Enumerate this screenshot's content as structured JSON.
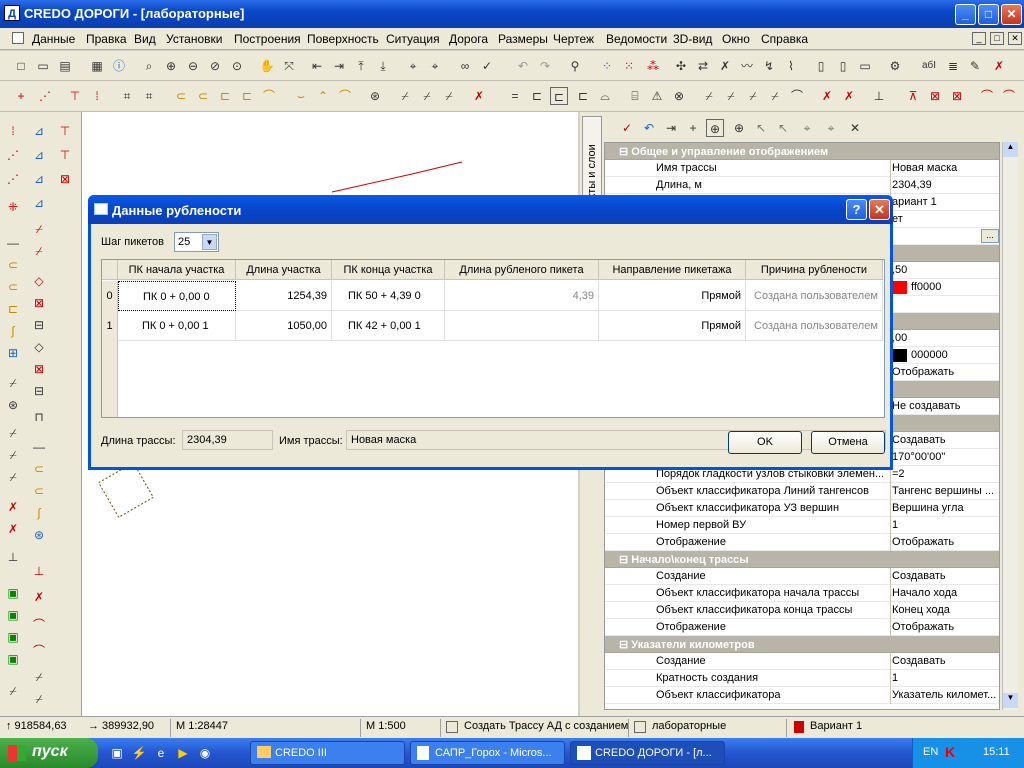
{
  "app": {
    "title": "CREDO ДОРОГИ - [лабораторные]",
    "icon_letter": "Д"
  },
  "window_controls": {
    "minimize": "_",
    "maximize": "□",
    "close": "✕"
  },
  "menu": [
    "Данные",
    "Правка",
    "Вид",
    "Установки",
    "Построения",
    "Поверхность",
    "Ситуация",
    "Дорога",
    "Размеры",
    "Чертеж",
    "Ведомости",
    "3D-вид",
    "Окно",
    "Справка"
  ],
  "right_panel": {
    "vertical_tab": "роекты и слои",
    "groups": [
      {
        "label": "Общее и управление отображением"
      }
    ],
    "rows": [
      {
        "type": "group",
        "name": "Общее и управление отображением"
      },
      {
        "name": "Имя трассы",
        "value": "Новая маска"
      },
      {
        "name": "Длина, м",
        "value": "2304,39"
      },
      {
        "name": "",
        "value": "ариант 1"
      },
      {
        "name": "",
        "value": "ет"
      },
      {
        "name": "",
        "value": ""
      },
      {
        "type": "group",
        "name": ""
      },
      {
        "name": "",
        "value": ",50"
      },
      {
        "name": "",
        "value": "ff0000"
      },
      {
        "name": "",
        "value": ""
      },
      {
        "type": "group",
        "name": ""
      },
      {
        "name": "",
        "value": ",00"
      },
      {
        "name": "",
        "value": "000000"
      },
      {
        "name": "",
        "value": "Отображать"
      },
      {
        "type": "group",
        "name": ""
      },
      {
        "name": "",
        "value": "Не создавать"
      },
      {
        "type": "group",
        "name": ""
      },
      {
        "name": "",
        "value": "Создавать"
      },
      {
        "name": "",
        "value": "170°00'00\""
      },
      {
        "name": "Порядок гладкости узлов стыковки элемен...",
        "value": "=2"
      },
      {
        "name": "Объект классификатора Линий тангенсов",
        "value": "Тангенс вершины ..."
      },
      {
        "name": "Объект классификатора УЗ вершин",
        "value": "Вершина угла"
      },
      {
        "name": "Номер первой ВУ",
        "value": "1"
      },
      {
        "name": "Отображение",
        "value": "Отображать"
      },
      {
        "type": "group",
        "name": "Начало\\конец трассы"
      },
      {
        "name": "Создание",
        "value": "Создавать"
      },
      {
        "name": "Объект классификатора начала трассы",
        "value": "Начало хода"
      },
      {
        "name": "Объект классификатора конца трассы",
        "value": "Конец хода"
      },
      {
        "name": "Отображение",
        "value": "Отображать"
      },
      {
        "type": "group",
        "name": "Указатели километров"
      },
      {
        "name": "Создание",
        "value": "Создавать"
      },
      {
        "name": "Кратность создания",
        "value": "1"
      },
      {
        "name": "Объект классификатора",
        "value": "Указатель километ..."
      }
    ]
  },
  "dialog": {
    "title": "Данные рублености",
    "help": "?",
    "close": "✕",
    "step_label": "Шаг пикетов",
    "step_value": "25",
    "columns": [
      "ПК начала участка",
      "Длина участка",
      "ПК конца участка",
      "Длина рубленого пикета",
      "Направление пикетажа",
      "Причина рублености"
    ],
    "rows": [
      {
        "num": "0",
        "pk_start": "ПК    0 +  0,00  0",
        "length": "1254,39",
        "pk_end": "ПК    50 +  4,39  0",
        "cut_len": "4,39",
        "direction": "Прямой",
        "reason": "Создана пользователем"
      },
      {
        "num": "1",
        "pk_start": "ПК    0 +  0,00  1",
        "length": "1050,00",
        "pk_end": "ПК    42 +  0,00  1",
        "cut_len": "",
        "direction": "Прямой",
        "reason": "Создана пользователем"
      }
    ],
    "route_len_label": "Длина трассы:",
    "route_len_value": "2304,39",
    "route_name_label": "Имя трассы:",
    "route_name_value": "Новая маска",
    "ok": "OK",
    "cancel": "Отмена"
  },
  "status": {
    "coord_y": "↑  918584,63",
    "coord_x": "→  389932,90",
    "scale1": "M 1:28447",
    "scale2": "M 1:500",
    "command": "Создать Трассу АД с созданием",
    "layer": "лабораторные",
    "variant": "Вариант 1"
  },
  "taskbar": {
    "start": "пуск",
    "tasks": [
      "CREDO III",
      "САПР_Горох - Micros...",
      "CREDO ДОРОГИ - [л..."
    ],
    "lang": "EN",
    "time": "15:11"
  },
  "colors": {
    "accent": "#0054e3",
    "line": "#cc0000",
    "swatch_red": "#ff0000",
    "swatch_black": "#000000"
  }
}
